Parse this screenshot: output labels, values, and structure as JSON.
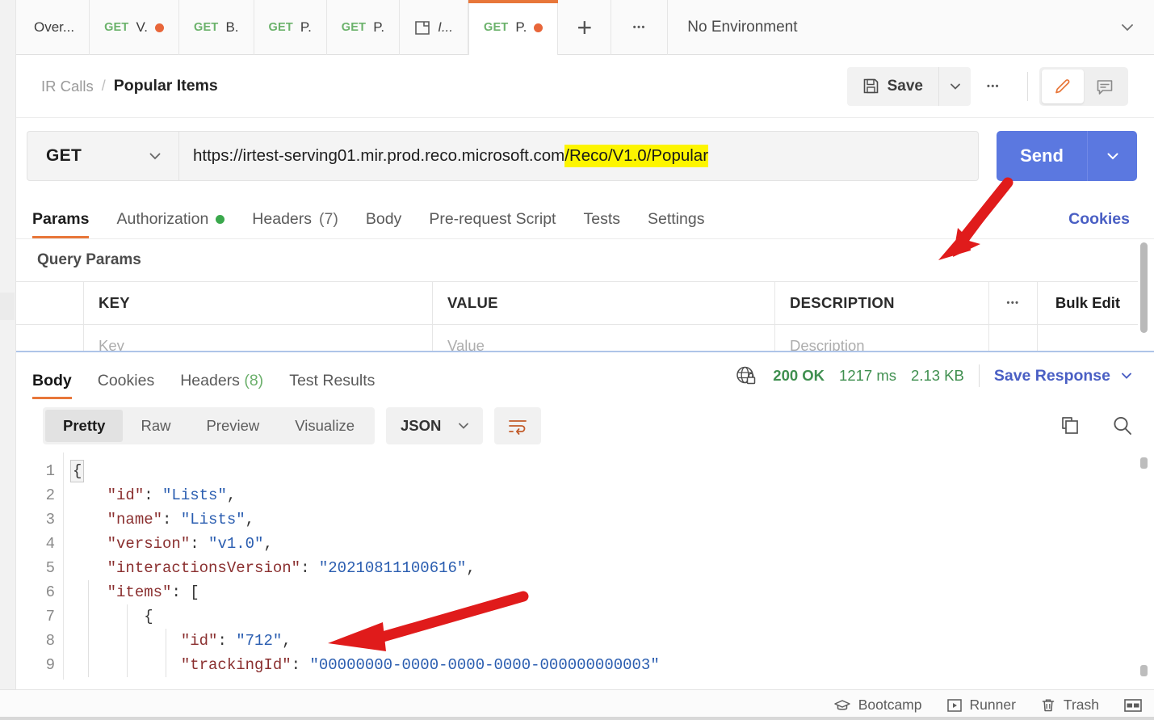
{
  "tabbar": {
    "tabs": [
      {
        "method": "",
        "title": "Over...",
        "dirty": false,
        "icon": "",
        "active": false
      },
      {
        "method": "GET",
        "title": "V.",
        "dirty": true,
        "icon": "",
        "active": false
      },
      {
        "method": "GET",
        "title": "B.",
        "dirty": false,
        "icon": "",
        "active": false
      },
      {
        "method": "GET",
        "title": "P.",
        "dirty": false,
        "icon": "",
        "active": false
      },
      {
        "method": "GET",
        "title": "P.",
        "dirty": false,
        "icon": "",
        "active": false
      },
      {
        "method": "",
        "title": "I...",
        "dirty": false,
        "icon": "collection-icon",
        "active": false
      },
      {
        "method": "GET",
        "title": "P.",
        "dirty": true,
        "icon": "",
        "active": true
      }
    ],
    "new_tab_label": "+",
    "more_tabs_label": "•••",
    "environment": "No Environment"
  },
  "breadcrumb": {
    "parent": "IR Calls",
    "separator": "/",
    "current": "Popular Items"
  },
  "actions": {
    "save_label": "Save",
    "save_icon": "floppy-disk-icon",
    "save_caret_icon": "chevron-down-icon",
    "more_label": "•••",
    "edit_icon": "pencil-icon",
    "comment_icon": "comment-icon"
  },
  "request": {
    "method": "GET",
    "url_prefix": "https://irtest-serving01.mir.prod.reco.microsoft.com",
    "url_highlight": "/Reco/V1.0/Popular",
    "highlight_color": "#fdf500",
    "send_label": "Send",
    "send_color": "#5b78e0",
    "tabs": [
      {
        "label": "Params",
        "badge": "",
        "dot": false,
        "active": true
      },
      {
        "label": "Authorization",
        "badge": "",
        "dot": true,
        "active": false
      },
      {
        "label": "Headers",
        "badge": "(7)",
        "dot": false,
        "active": false
      },
      {
        "label": "Body",
        "badge": "",
        "dot": false,
        "active": false
      },
      {
        "label": "Pre-request Script",
        "badge": "",
        "dot": false,
        "active": false
      },
      {
        "label": "Tests",
        "badge": "",
        "dot": false,
        "active": false
      },
      {
        "label": "Settings",
        "badge": "",
        "dot": false,
        "active": false
      }
    ],
    "cookies_link": "Cookies"
  },
  "query_params": {
    "section_title": "Query Params",
    "columns": [
      "KEY",
      "VALUE",
      "DESCRIPTION"
    ],
    "more_label": "•••",
    "bulk_edit_label": "Bulk Edit",
    "placeholder_row": {
      "key": "Key",
      "value": "Value",
      "description": "Description"
    }
  },
  "response": {
    "tabs": [
      {
        "label": "Body",
        "count": "",
        "active": true
      },
      {
        "label": "Cookies",
        "count": "",
        "active": false
      },
      {
        "label": "Headers",
        "count": "(8)",
        "active": false
      },
      {
        "label": "Test Results",
        "count": "",
        "active": false
      }
    ],
    "globe_lock_icon": "globe-lock-icon",
    "status": "200 OK",
    "time": "1217 ms",
    "size": "2.13 KB",
    "save_response_label": "Save Response",
    "save_response_caret": "chevron-down-icon",
    "format_tabs": [
      {
        "label": "Pretty",
        "active": true
      },
      {
        "label": "Raw",
        "active": false
      },
      {
        "label": "Preview",
        "active": false
      },
      {
        "label": "Visualize",
        "active": false
      }
    ],
    "language": "JSON",
    "wrap_icon": "word-wrap-icon",
    "copy_icon": "copy-icon",
    "search_icon": "search-icon",
    "body_lines": [
      {
        "n": "1",
        "indent": 0,
        "segments": [
          {
            "t": "{",
            "c": "punc"
          }
        ],
        "fold": true
      },
      {
        "n": "2",
        "indent": 1,
        "segments": [
          {
            "t": "\"id\"",
            "c": "key"
          },
          {
            "t": ": ",
            "c": "punc"
          },
          {
            "t": "\"Lists\"",
            "c": "str"
          },
          {
            "t": ",",
            "c": "punc"
          }
        ]
      },
      {
        "n": "3",
        "indent": 1,
        "segments": [
          {
            "t": "\"name\"",
            "c": "key"
          },
          {
            "t": ": ",
            "c": "punc"
          },
          {
            "t": "\"Lists\"",
            "c": "str"
          },
          {
            "t": ",",
            "c": "punc"
          }
        ]
      },
      {
        "n": "4",
        "indent": 1,
        "segments": [
          {
            "t": "\"version\"",
            "c": "key"
          },
          {
            "t": ": ",
            "c": "punc"
          },
          {
            "t": "\"v1.0\"",
            "c": "str"
          },
          {
            "t": ",",
            "c": "punc"
          }
        ]
      },
      {
        "n": "5",
        "indent": 1,
        "segments": [
          {
            "t": "\"interactionsVersion\"",
            "c": "key"
          },
          {
            "t": ": ",
            "c": "punc"
          },
          {
            "t": "\"20210811100616\"",
            "c": "str"
          },
          {
            "t": ",",
            "c": "punc"
          }
        ]
      },
      {
        "n": "6",
        "indent": 1,
        "segments": [
          {
            "t": "\"items\"",
            "c": "key"
          },
          {
            "t": ": [",
            "c": "punc"
          }
        ]
      },
      {
        "n": "7",
        "indent": 2,
        "segments": [
          {
            "t": "{",
            "c": "punc"
          }
        ]
      },
      {
        "n": "8",
        "indent": 3,
        "segments": [
          {
            "t": "\"id\"",
            "c": "key"
          },
          {
            "t": ": ",
            "c": "punc"
          },
          {
            "t": "\"712\"",
            "c": "str"
          },
          {
            "t": ",",
            "c": "punc"
          }
        ]
      },
      {
        "n": "9",
        "indent": 3,
        "segments": [
          {
            "t": "\"trackingId\"",
            "c": "key"
          },
          {
            "t": ": ",
            "c": "punc"
          },
          {
            "t": "\"00000000-0000-0000-0000-000000000003\"",
            "c": "str"
          }
        ]
      }
    ]
  },
  "statusbar": {
    "items": [
      {
        "label": "Bootcamp",
        "icon": "graduation-cap-icon"
      },
      {
        "label": "Runner",
        "icon": "play-box-icon"
      },
      {
        "label": "Trash",
        "icon": "trash-icon"
      }
    ],
    "layout_icon": "two-pane-layout-icon"
  },
  "annotations": {
    "arrow_color": "#e01b1b",
    "arrow_to_send": "arrow-pointing-to-send-button",
    "arrow_to_id": "arrow-pointing-to-id-712"
  }
}
